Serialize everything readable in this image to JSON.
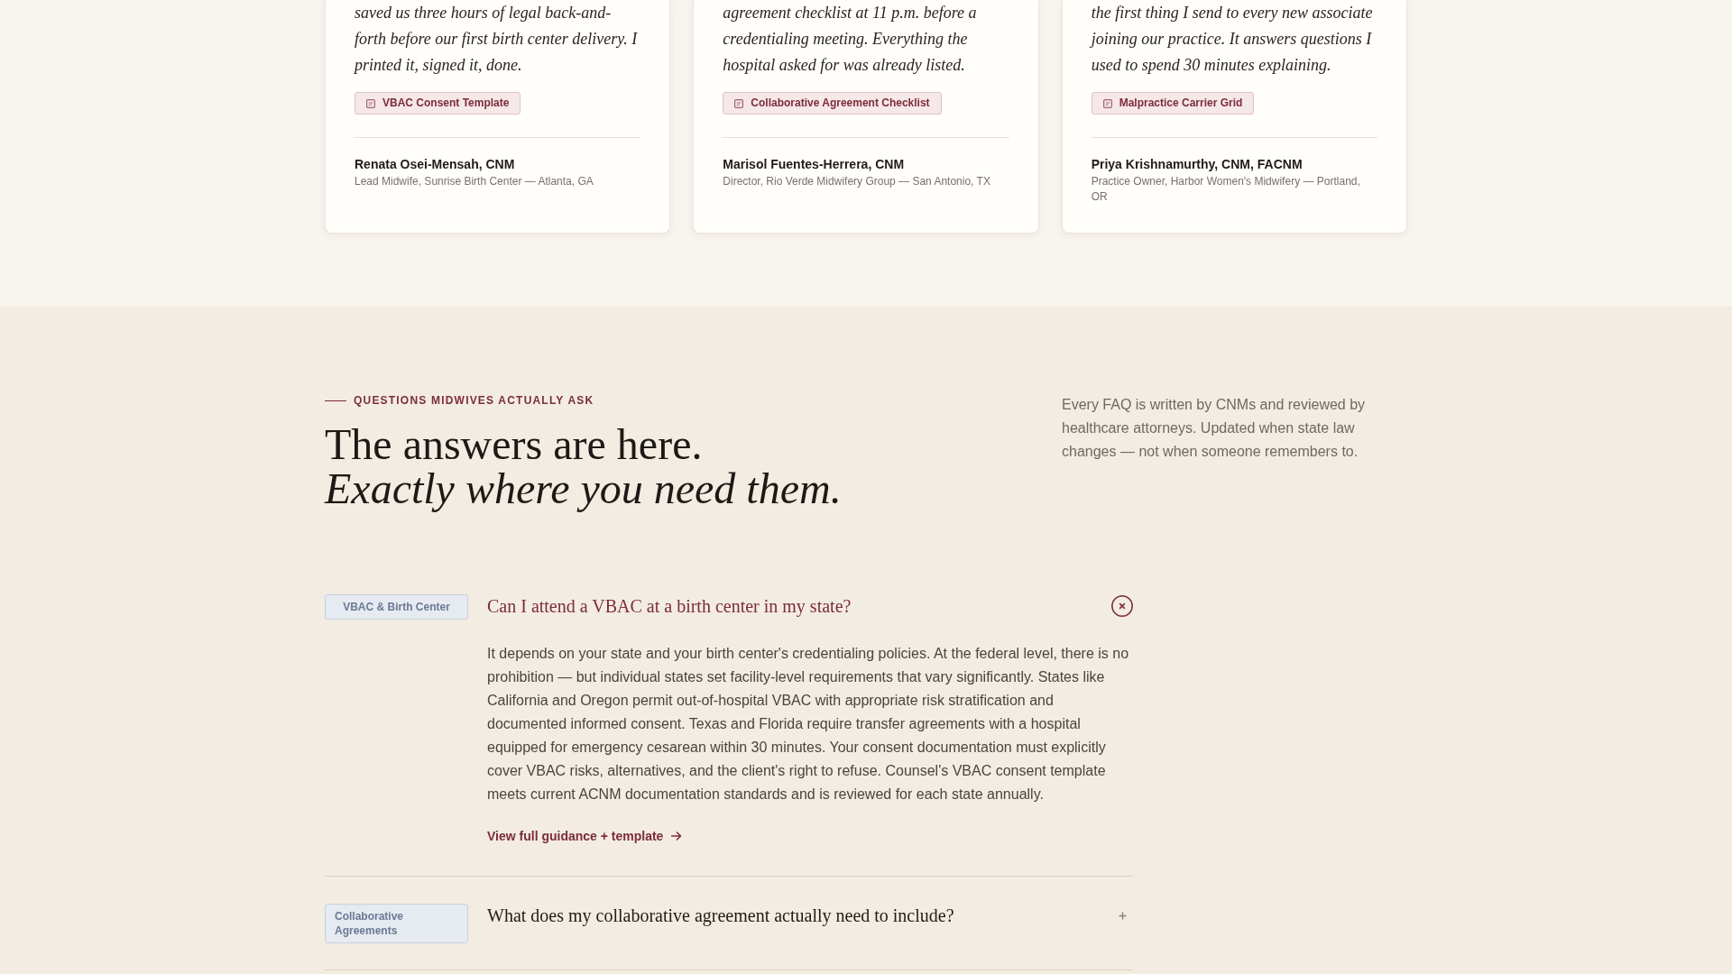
{
  "testimonials": [
    {
      "quote": "saved us three hours of legal back-and-forth before our first birth center delivery. I printed it, signed it, done.",
      "resource": "VBAC Consent Template",
      "name": "Renata Osei-Mensah, CNM",
      "role": "Lead Midwife, Sunrise Birth Center — Atlanta, GA"
    },
    {
      "quote": "agreement checklist at 11 p.m. before a credentialing meeting. Everything the hospital asked for was already listed.",
      "resource": "Collaborative Agreement Checklist",
      "name": "Marisol Fuentes-Herrera, CNM",
      "role": "Director, Rio Verde Midwifery Group — San Antonio, TX"
    },
    {
      "quote": "the first thing I send to every new associate joining our practice. It answers questions I used to spend 30 minutes explaining.",
      "resource": "Malpractice Carrier Grid",
      "name": "Priya Krishnamurthy, CNM, FACNM",
      "role": "Practice Owner, Harbor Women's Midwifery — Portland, OR"
    }
  ],
  "faq_section": {
    "eyebrow": "QUESTIONS MIDWIVES ACTUALLY ASK",
    "title": "The answers are here. *Exactly where you need them.*",
    "intro": "Every FAQ is written by CNMs and reviewed by healthcare attorneys. Updated when state law changes — not when someone remembers to.",
    "items": [
      {
        "category": "VBAC & Birth Center",
        "question": "Can I attend a VBAC at a birth center in my state?",
        "expanded": true,
        "answer": "It depends on your state and your birth center's credentialing policies. At the federal level, there is no prohibition — but individual states set facility-level requirements that vary significantly. States like California and Oregon permit out-of-hospital VBAC with appropriate risk stratification and documented informed consent. Texas and Florida require transfer agreements with a hospital equipped for emergency cesarean within 30 minutes. Your consent documentation must explicitly cover VBAC risks, alternatives, and the client's right to refuse. Counsel's VBAC consent template meets current ACNM documentation standards and is reviewed for each state annually.",
        "link": "View full guidance + template"
      },
      {
        "category": "Collaborative Agreements",
        "question": "What does my collaborative agreement actually need to include?",
        "expanded": false
      }
    ]
  }
}
